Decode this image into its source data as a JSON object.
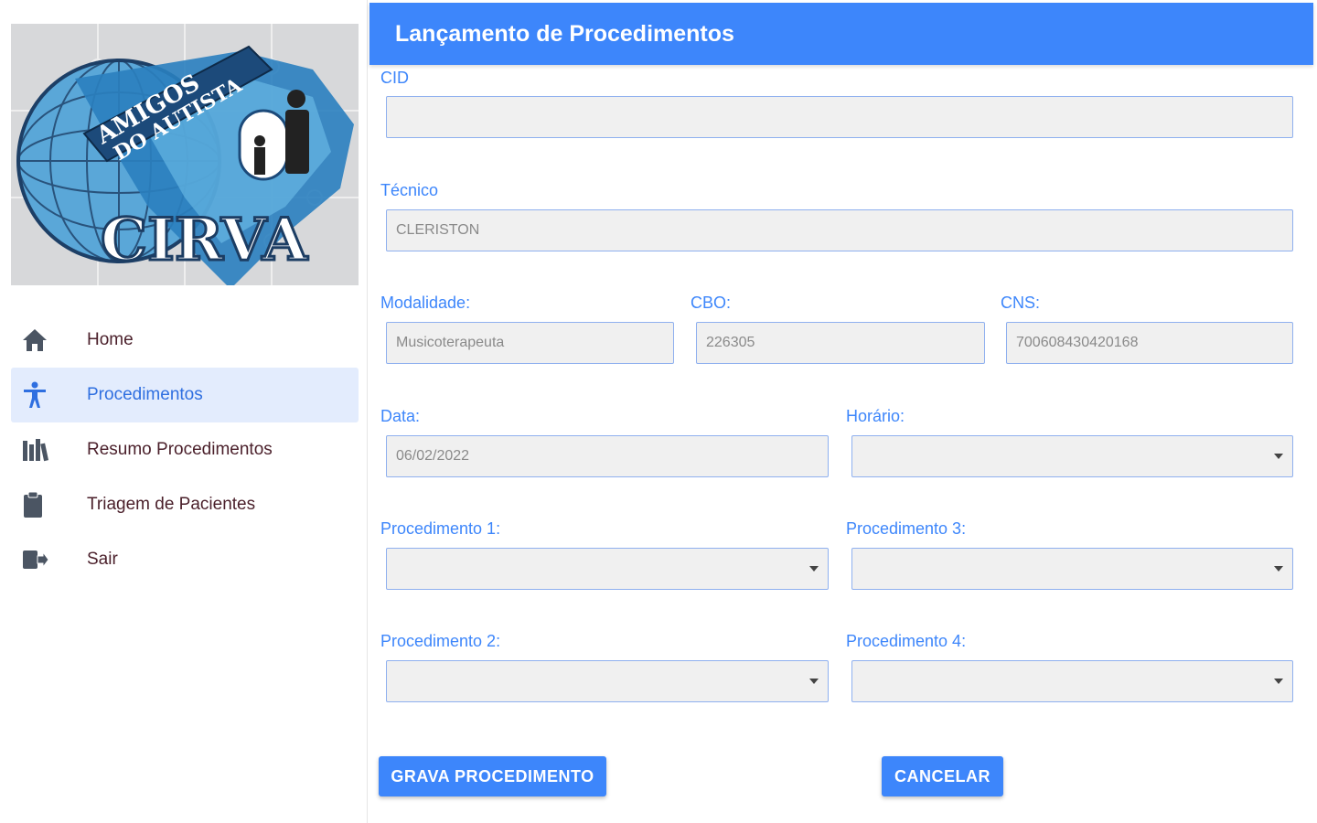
{
  "logo": {
    "alt": "CIRVA Amigos do Autista logo",
    "line1": "AMIGOS",
    "line2": "DO AUTISTA",
    "brand": "CIRVA"
  },
  "sidebar": {
    "items": [
      {
        "label": "Home",
        "icon": "home-icon"
      },
      {
        "label": "Procedimentos",
        "icon": "accessibility-icon",
        "active": true
      },
      {
        "label": "Resumo Procedimentos",
        "icon": "books-icon"
      },
      {
        "label": "Triagem de Pacientes",
        "icon": "clipboard-icon"
      },
      {
        "label": "Sair",
        "icon": "logout-icon"
      }
    ]
  },
  "header": {
    "title": "Lançamento de Procedimentos"
  },
  "form": {
    "cid": {
      "label": "CID",
      "value": ""
    },
    "tecnico": {
      "label": "Técnico",
      "value": "CLERISTON"
    },
    "modalidade": {
      "label": "Modalidade:",
      "value": "Musicoterapeuta"
    },
    "cbo": {
      "label": "CBO:",
      "value": "226305"
    },
    "cns": {
      "label": "CNS:",
      "value": "700608430420168"
    },
    "data": {
      "label": "Data:",
      "value": "06/02/2022"
    },
    "horario": {
      "label": "Horário:",
      "value": ""
    },
    "procedimento1": {
      "label": "Procedimento 1:",
      "value": ""
    },
    "procedimento2": {
      "label": "Procedimento 2:",
      "value": ""
    },
    "procedimento3": {
      "label": "Procedimento 3:",
      "value": ""
    },
    "procedimento4": {
      "label": "Procedimento 4:",
      "value": ""
    }
  },
  "buttons": {
    "save": "GRAVA PROCEDIMENTO",
    "cancel": "CANCELAR"
  },
  "colors": {
    "accent": "#3d86fb",
    "active_bg": "#e3ecfd",
    "input_bg": "#f0f0f0"
  }
}
